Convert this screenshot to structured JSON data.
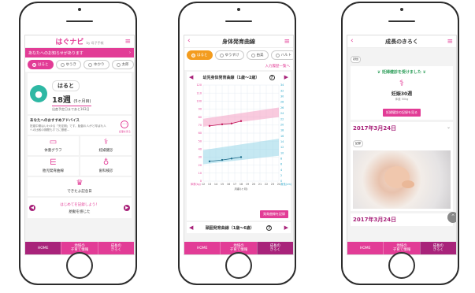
{
  "phone1": {
    "app_title": "はぐナビ",
    "app_subtitle": "by 母子手帳",
    "notice": "あなたへのお知らせがあります",
    "notice_arrow": "›",
    "children": [
      "はると",
      "ゆうき",
      "ゆかり",
      "太郎",
      "ハ"
    ],
    "child_name": "はると",
    "age_weeks": "18週",
    "age_months": "(5ヶ月目)",
    "days_since_birth": "出産予定日まであと163日",
    "advice_title": "あなたへのおすすめアドバイス",
    "advice_body": "妊娠中期はいわゆる「安定期」です。胎盤の人がと呼ばれ人への比較の期間もすでに基礎...",
    "advice_more": "記事を見る",
    "tiles": [
      "体重グラフ",
      "妊婦健診",
      "胎児発育曲線",
      "歯科検診"
    ],
    "tile_wide": "できたよ記念日",
    "cta_text": "はじめてを記録しよう！",
    "cta_sub": "胎動を感じた",
    "tabs": [
      "HOME",
      "地域の\n子育て情報",
      "成長の\nきろく"
    ],
    "active_tab": 0
  },
  "phone2": {
    "title": "身体発育曲線",
    "children": [
      "はると",
      "ゆうすけ",
      "由美",
      "ハルト"
    ],
    "input_link": "入力履歴一覧へ",
    "chart_title": "幼児身体発育曲線（1歳〜2歳）",
    "second_chart_title": "頭囲発育曲線（1歳〜6歳）",
    "record_button": "発育曲線を記録",
    "tabs": [
      "HOME",
      "地域の\n子育て情報",
      "成長の\nきろく"
    ],
    "active_tab": 2
  },
  "phone3": {
    "title": "成長のきろく",
    "top_badge": "初回",
    "banner": "妊婦健診を受けました",
    "weeks": "妊娠30週",
    "weight": "体重 50kg",
    "record_button": "妊婦健診の記録を見る",
    "card1_date": "2017年3月24日",
    "card1_badge": "記録",
    "card2_date": "2017年3月24日",
    "tabs": [
      "HOME",
      "地域の\n子育て情報",
      "成長の\nきろく"
    ],
    "active_tab": 2
  },
  "chart_data": {
    "type": "line",
    "title": "幼児身体発育曲線（1歳〜2歳）",
    "xlabel": "月齢(ヶ月)",
    "ylabel_left": "体重(kg)",
    "ylabel_right": "身長(cm)",
    "x": [
      12,
      13,
      14,
      15,
      16,
      17,
      18,
      19,
      20,
      21,
      22,
      23,
      24
    ],
    "xlim": [
      12,
      24
    ],
    "ylim_left": [
      0,
      120
    ],
    "ylim_right": [
      0,
      34
    ],
    "y_ticks_left": [
      0,
      10,
      20,
      30,
      40,
      50,
      60,
      70,
      80,
      90,
      100,
      110,
      120
    ],
    "y_ticks_right": [
      0,
      2,
      4,
      6,
      8,
      10,
      12,
      14,
      16,
      18,
      20,
      22,
      24,
      26,
      28,
      30,
      32,
      34
    ],
    "series": [
      {
        "name": "身長",
        "x": [
          13,
          15,
          16.5,
          18
        ],
        "values": [
          69,
          71,
          72,
          75
        ]
      },
      {
        "name": "体重",
        "x": [
          13,
          15,
          16.5,
          18
        ],
        "values": [
          7,
          7.5,
          8,
          8.5
        ]
      }
    ],
    "bands": [
      {
        "name": "身長",
        "lower_start": 68,
        "lower_end": 80,
        "upper_start": 78,
        "upper_end": 92,
        "color": "#f5a6c8"
      },
      {
        "name": "体重",
        "lower_start": 6,
        "lower_end": 9,
        "upper_start": 11,
        "upper_end": 15,
        "color": "#9fd9ea"
      }
    ],
    "grid": true
  },
  "colors": {
    "brand": "#e23c96",
    "dark": "#a8237a",
    "orange": "#f39c1f",
    "teal": "#2eb8a4"
  }
}
